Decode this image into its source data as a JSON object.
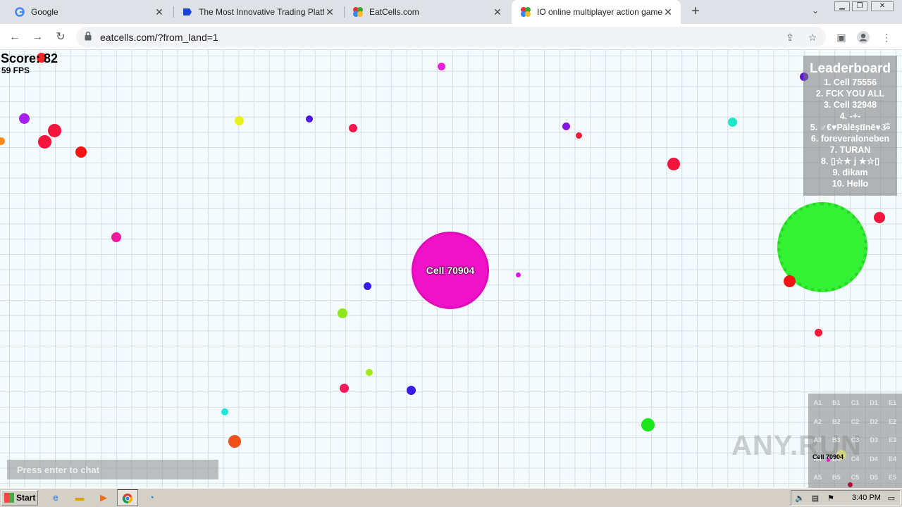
{
  "browser": {
    "tabs": [
      {
        "title": "Google",
        "icon": "google-icon"
      },
      {
        "title": "The Most Innovative Trading Platform",
        "icon": "trading-platform-icon"
      },
      {
        "title": "EatCells.com",
        "icon": "eatcells-icon"
      },
      {
        "title": "IO online multiplayer action game. S",
        "icon": "eatcells-icon",
        "active": true
      }
    ],
    "new_tab": "+",
    "url": "eatcells.com/?from_land=1"
  },
  "game": {
    "score": "Score: 82",
    "fps": "59 FPS",
    "player_name": "Cell 70904",
    "player_color": "#f012c8",
    "leaderboard": {
      "title": "Leaderboard",
      "entries": [
        "1. Cell 75556",
        "2. FCK YOU ALL",
        "3. Cell 32948",
        "4. -+-",
        "5. ♂€♥Pälēştīnē♥ૐ",
        "6. foreveraloneben",
        "7. TURAN",
        "8. ▯☆★ j ★☆▯",
        "9. dikam",
        "10. Hello"
      ]
    },
    "chat_placeholder": "Press enter to chat",
    "minimap": {
      "grid": [
        [
          "A1",
          "B1",
          "C1",
          "D1",
          "E1"
        ],
        [
          "A2",
          "B2",
          "C2",
          "D2",
          "E2"
        ],
        [
          "A3",
          "B3",
          "C3",
          "D3",
          "E3"
        ],
        [
          "A4",
          "B4",
          "C4",
          "D4",
          "E4"
        ],
        [
          "A5",
          "B5",
          "C5",
          "D5",
          "E5"
        ]
      ],
      "player_label": "Cell 70904"
    },
    "watermark": "ANY.RUN"
  },
  "taskbar": {
    "start_label": "Start",
    "clock": "3:40 PM"
  }
}
